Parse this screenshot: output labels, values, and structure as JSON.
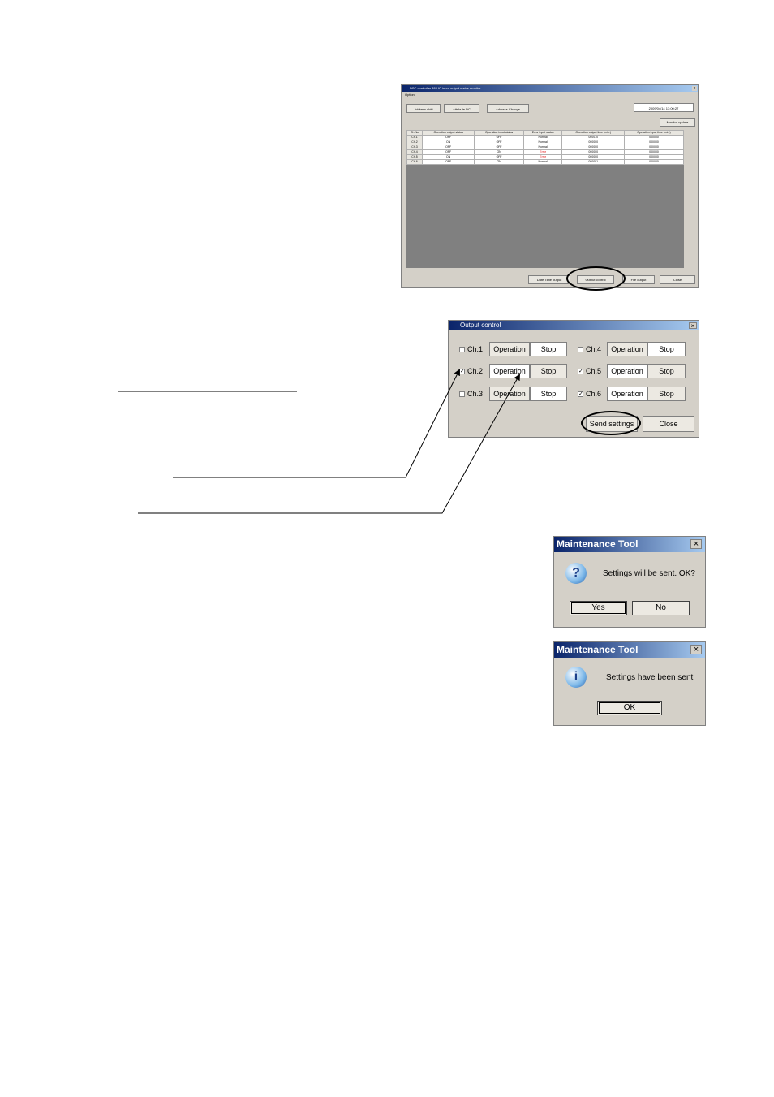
{
  "main_window": {
    "title": "DSC controller 888 IO input output status monitor",
    "menu": "Option",
    "tabs": [
      "Address shift",
      "Attribute DC",
      "Address Change"
    ],
    "datetime": "2009/04/14 13:00:27",
    "monitor_update_label": "Monitor update",
    "table": {
      "headers": [
        "Ch No",
        "Operation output status",
        "Operation input status",
        "Error input status",
        "Operation output time (min.)",
        "Operation input time (min.)"
      ],
      "rows": [
        [
          "Ch.1",
          "OFF",
          "OFF",
          "Normal",
          "000070",
          "000000"
        ],
        [
          "Ch.2",
          "ON",
          "OFF",
          "Normal",
          "000000",
          "000000"
        ],
        [
          "Ch.3",
          "OFF",
          "OFF",
          "Normal",
          "000000",
          "000000"
        ],
        [
          "Ch.4",
          "OFF",
          "ON",
          "Error",
          "000000",
          "000000"
        ],
        [
          "Ch.5",
          "ON",
          "OFF",
          "Error",
          "000000",
          "000000"
        ],
        [
          "Ch.6",
          "OFF",
          "ON",
          "Normal",
          "000001",
          "000000"
        ]
      ]
    },
    "buttons": {
      "date_time": "Date/Time output",
      "output_control": "Output control",
      "file_output": "File output",
      "close": "Close"
    }
  },
  "output_control": {
    "title": "Output control",
    "channels": [
      {
        "label": "Ch.1",
        "checked": false,
        "operation": "Operation",
        "stop": "Stop"
      },
      {
        "label": "Ch.2",
        "checked": true,
        "operation": "Operation",
        "stop": "Stop"
      },
      {
        "label": "Ch.3",
        "checked": false,
        "operation": "Operation",
        "stop": "Stop"
      },
      {
        "label": "Ch.4",
        "checked": false,
        "operation": "Operation",
        "stop": "Stop"
      },
      {
        "label": "Ch.5",
        "checked": true,
        "operation": "Operation",
        "stop": "Stop"
      },
      {
        "label": "Ch.6",
        "checked": true,
        "operation": "Operation",
        "stop": "Stop"
      }
    ],
    "send_settings": "Send settings",
    "close": "Close"
  },
  "confirm_dialog": {
    "title": "Maintenance Tool",
    "message": "Settings will be sent. OK?",
    "yes": "Yes",
    "no": "No"
  },
  "info_dialog": {
    "title": "Maintenance Tool",
    "message": "Settings have been sent",
    "ok": "OK"
  },
  "icons": {
    "question": "?",
    "info": "i",
    "close": "×",
    "check": "✓"
  }
}
